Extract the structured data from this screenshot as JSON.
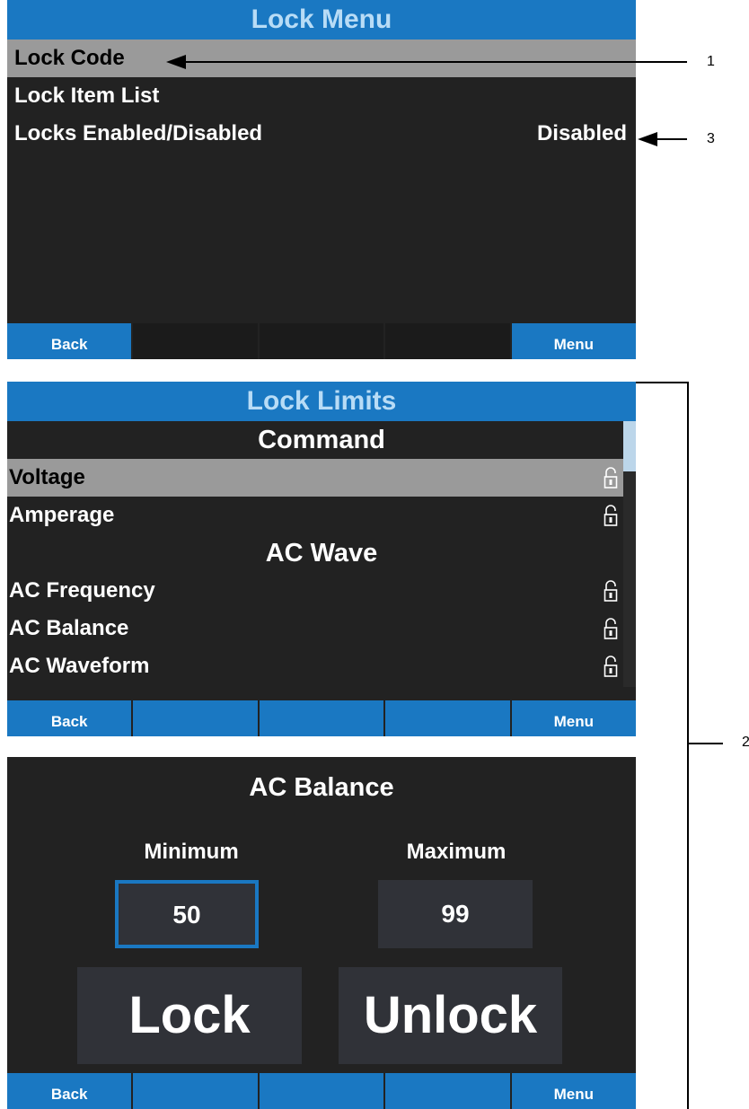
{
  "lock_menu": {
    "title": "Lock Menu",
    "items": [
      {
        "label": "Lock Code",
        "value": ""
      },
      {
        "label": "Lock Item List",
        "value": ""
      },
      {
        "label": "Locks Enabled/Disabled",
        "value": "Disabled"
      }
    ],
    "selected_index": 0,
    "footer": [
      "Back",
      "",
      "",
      "",
      "Menu"
    ]
  },
  "lock_limits": {
    "title": "Lock Limits",
    "sections": [
      {
        "header": "Command",
        "items": [
          "Voltage",
          "Amperage"
        ]
      },
      {
        "header": "AC Wave",
        "items": [
          "AC Frequency",
          "AC Balance",
          "AC Waveform"
        ]
      }
    ],
    "selected_item": "Voltage",
    "item_icon": "unlocked-padlock-icon",
    "footer": [
      "Back",
      "",
      "",
      "",
      "Menu"
    ]
  },
  "ac_balance": {
    "title": "AC Balance",
    "minimum_label": "Minimum",
    "minimum_value": "50",
    "maximum_label": "Maximum",
    "maximum_value": "99",
    "lock_label": "Lock",
    "unlock_label": "Unlock",
    "footer": [
      "Back",
      "",
      "",
      "",
      "Menu"
    ]
  },
  "callouts": [
    "1",
    "2",
    "3"
  ],
  "colors": {
    "accent": "#1a78c2",
    "screen_bg": "#222222",
    "selection": "#9a9a9a",
    "title_text": "#b8dcf6"
  }
}
